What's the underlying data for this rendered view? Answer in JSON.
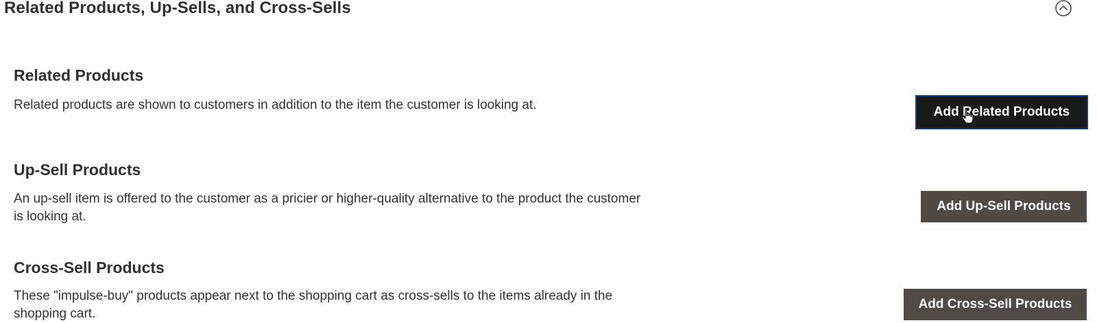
{
  "section": {
    "title": "Related Products, Up-Sells, and Cross-Sells",
    "toggle_icon": "chevron-up-circle-icon"
  },
  "related": {
    "title": "Related Products",
    "description": "Related products are shown to customers in addition to the item the customer is looking at.",
    "button_label": "Add Related Products"
  },
  "upsell": {
    "title": "Up-Sell Products",
    "description": "An up-sell item is offered to the customer as a pricier or higher-quality alternative to the product the customer is looking at.",
    "button_label": "Add Up-Sell Products"
  },
  "crosssell": {
    "title": "Cross-Sell Products",
    "description": "These \"impulse-buy\" products appear next to the shopping cart as cross-sells to the items already in the shopping cart.",
    "button_label": "Add Cross-Sell Products"
  },
  "colors": {
    "button_bg": "#514943",
    "button_focused_bg": "#1a1a1a",
    "focus_ring": "#0e3d8a",
    "text": "#333333"
  }
}
